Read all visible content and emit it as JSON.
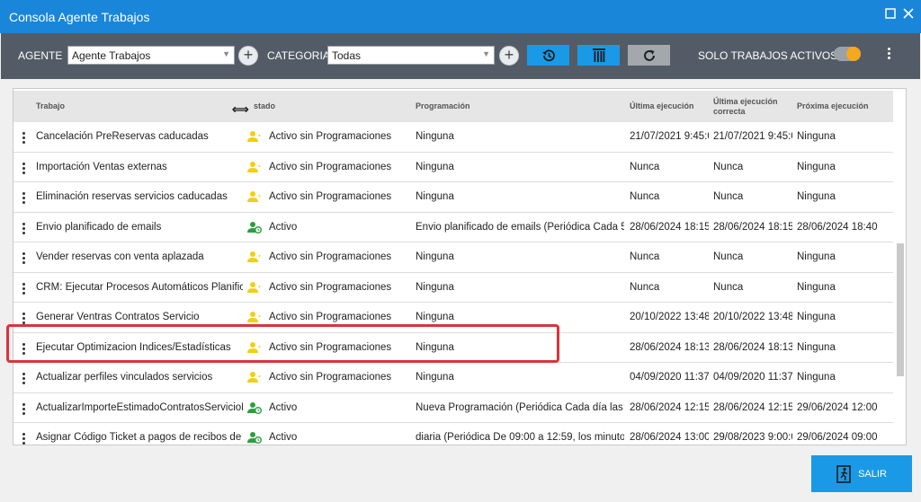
{
  "window": {
    "title": "Consola Agente Trabajos"
  },
  "toolbar": {
    "agente_label": "AGENTE",
    "agente_value": "Agente Trabajos",
    "categoria_label": "CATEGORIA",
    "categoria_value": "Todas",
    "solo_activos_label": "SOLO TRABAJOS ACTIVOS",
    "solo_activos_on": true
  },
  "grid": {
    "columns": [
      "Trabajo",
      "Estado",
      "Programación",
      "Última ejecución",
      "Última ejecución correcta",
      "Próxima ejecución"
    ],
    "resize_cursor": "⟺",
    "header_estado_visible": "stado",
    "rows": [
      {
        "trabajo": "Cancelación PreReservas caducadas",
        "estado": "Activo sin Programaciones",
        "estado_kind": "warning",
        "programacion": "Ninguna",
        "ultima": "21/07/2021 9:45:0",
        "correcta": "21/07/2021 9:45:0",
        "proxima": "Ninguna"
      },
      {
        "trabajo": "Importación Ventas externas",
        "estado": "Activo sin Programaciones",
        "estado_kind": "warning",
        "programacion": "Ninguna",
        "ultima": "Nunca",
        "correcta": "Nunca",
        "proxima": "Ninguna"
      },
      {
        "trabajo": "Eliminación reservas servicios caducadas",
        "estado": "Activo sin Programaciones",
        "estado_kind": "warning",
        "programacion": "Ninguna",
        "ultima": "Nunca",
        "correcta": "Nunca",
        "proxima": "Ninguna"
      },
      {
        "trabajo": "Envio planificado de emails",
        "estado": "Activo",
        "estado_kind": "active",
        "programacion": "Envio planificado de emails (Periódica Cada 5 m",
        "ultima": "28/06/2024 18:15:0",
        "correcta": "28/06/2024 18:15:0",
        "proxima": "28/06/2024 18:40"
      },
      {
        "trabajo": "Vender reservas con venta aplazada",
        "estado": "Activo sin Programaciones",
        "estado_kind": "warning",
        "programacion": "Ninguna",
        "ultima": "Nunca",
        "correcta": "Nunca",
        "proxima": "Ninguna"
      },
      {
        "trabajo": "CRM: Ejecutar Procesos Automáticos Planificac",
        "estado": "Activo sin Programaciones",
        "estado_kind": "warning",
        "programacion": "Ninguna",
        "ultima": "Nunca",
        "correcta": "Nunca",
        "proxima": "Ninguna"
      },
      {
        "trabajo": "Generar Ventras Contratos Servicio",
        "estado": "Activo sin Programaciones",
        "estado_kind": "warning",
        "programacion": "Ninguna",
        "ultima": "20/10/2022 13:48:",
        "correcta": "20/10/2022 13:48:",
        "proxima": "Ninguna"
      },
      {
        "trabajo": "Ejecutar Optimizacion Indices/Estadísticas",
        "estado": "Activo sin Programaciones",
        "estado_kind": "warning",
        "programacion": "Ninguna",
        "ultima": "28/06/2024 18:13:",
        "correcta": "28/06/2024 18:13:",
        "proxima": "Ninguna"
      },
      {
        "trabajo": "Actualizar perfiles vinculados servicios",
        "estado": "Activo sin Programaciones",
        "estado_kind": "warning",
        "programacion": "Ninguna",
        "ultima": "04/09/2020 11:37:",
        "correcta": "04/09/2020 11:37:",
        "proxima": "Ninguna"
      },
      {
        "trabajo": "ActualizarImporteEstimadoContratosServicioN",
        "estado": "Activo",
        "estado_kind": "active",
        "programacion": "Nueva Programación (Periódica Cada día las ho",
        "ultima": "28/06/2024 12:15:",
        "correcta": "28/06/2024 12:15:",
        "proxima": "29/06/2024 12:00"
      },
      {
        "trabajo": "Asignar Código Ticket a pagos de recibos de re",
        "estado": "Activo",
        "estado_kind": "active",
        "programacion": "diaria (Periódica De 09:00 a 12:59, los minutos 0",
        "ultima": "28/06/2024 13:00:",
        "correcta": "29/08/2023 9:00:0",
        "proxima": "29/06/2024 09:00"
      }
    ]
  },
  "footer": {
    "exit_label": "SALIR"
  },
  "colors": {
    "titlebar": "#1a86d9",
    "toolbar": "#535c66",
    "accent": "#1a9ae6",
    "toggle": "#f6a81b",
    "warning_icon": "#f2cf10",
    "active_icon": "#2e9e3e",
    "highlight": "#d9343b"
  }
}
